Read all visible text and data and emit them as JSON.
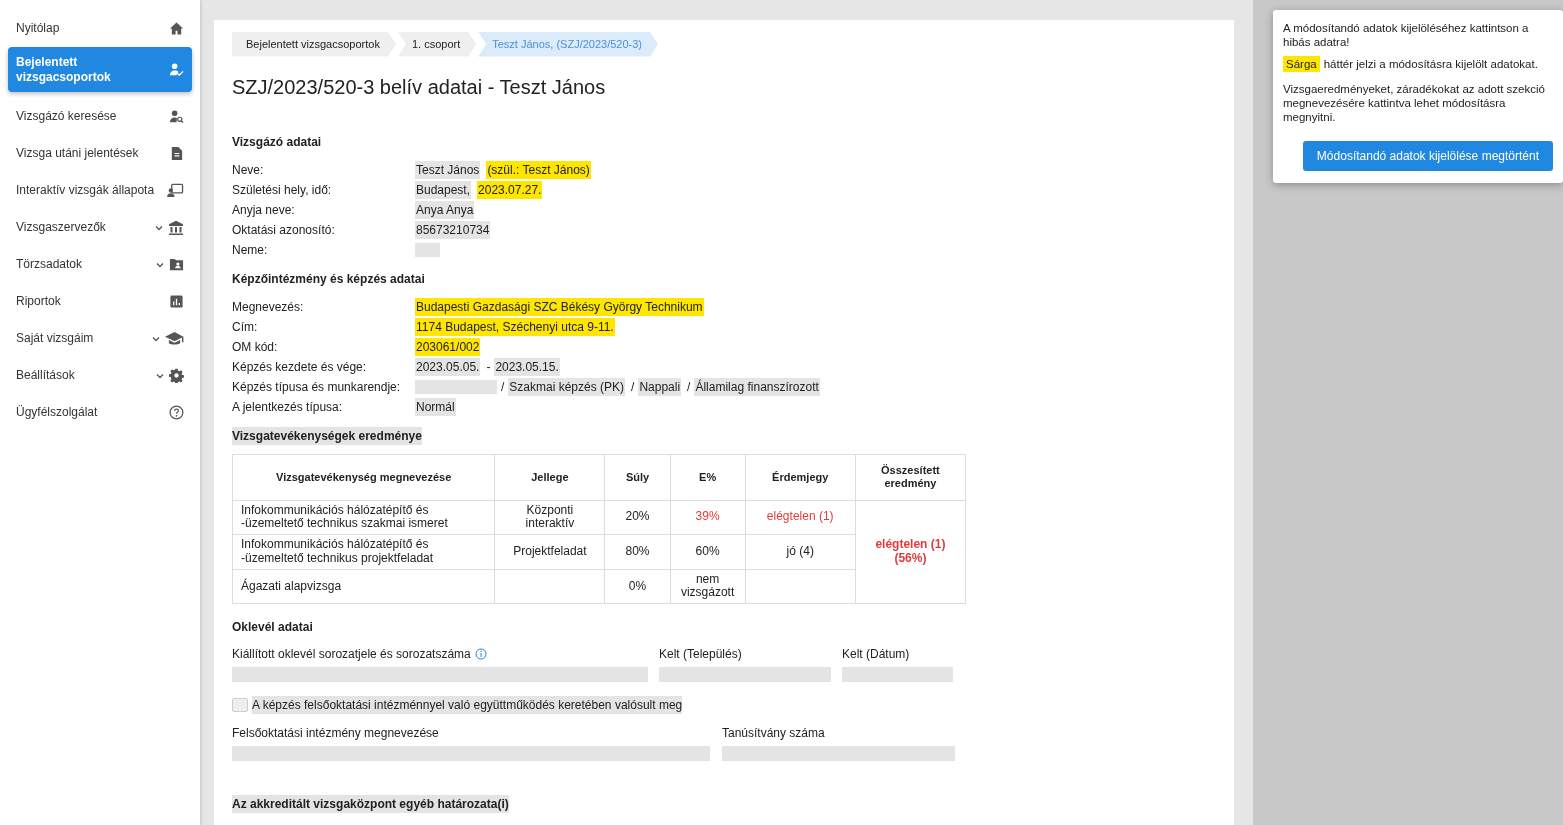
{
  "sidebar": {
    "items": [
      {
        "label": "Nyitólap",
        "selected": false,
        "expandable": false
      },
      {
        "label": "Bejelentett vizsgacsoportok",
        "selected": true,
        "expandable": false
      },
      {
        "label": "Vizsgázó keresése",
        "selected": false,
        "expandable": false
      },
      {
        "label": "Vizsga utáni jelentések",
        "selected": false,
        "expandable": false
      },
      {
        "label": "Interaktív vizsgák állapota",
        "selected": false,
        "expandable": false
      },
      {
        "label": "Vizsgaszervezők",
        "selected": false,
        "expandable": true
      },
      {
        "label": "Törzsadatok",
        "selected": false,
        "expandable": true
      },
      {
        "label": "Riportok",
        "selected": false,
        "expandable": false
      },
      {
        "label": "Saját vizsgáim",
        "selected": false,
        "expandable": true
      },
      {
        "label": "Beállítások",
        "selected": false,
        "expandable": true
      },
      {
        "label": "Ügyfélszolgálat",
        "selected": false,
        "expandable": false
      }
    ]
  },
  "breadcrumb": [
    {
      "label": "Bejelentett vizsgacsoportok",
      "selected": false
    },
    {
      "label": "1. csoport",
      "selected": false
    },
    {
      "label": "Teszt János, (SZJ/2023/520-3)",
      "selected": true
    }
  ],
  "title": "SZJ/2023/520-3 belív adatai - Teszt János",
  "sections": [
    {
      "heading": "Vizsgázó adatai",
      "editable": false,
      "fields": [
        {
          "label": "Neve:",
          "parts": [
            {
              "kind": "value",
              "text": "Teszt János",
              "marked": false
            },
            {
              "kind": "value",
              "text": "(szül.: Teszt János)",
              "marked": true
            }
          ]
        },
        {
          "label": "Születési hely, idő:",
          "parts": [
            {
              "kind": "value",
              "text": "Budapest,",
              "marked": false
            },
            {
              "kind": "value",
              "text": "2023.07.27.",
              "marked": true
            }
          ]
        },
        {
          "label": "Anyja neve:",
          "parts": [
            {
              "kind": "value",
              "text": "Anya Anya",
              "marked": false
            }
          ]
        },
        {
          "label": "Oktatási azonosító:",
          "parts": [
            {
              "kind": "value",
              "text": "85673210734",
              "marked": false
            }
          ]
        },
        {
          "label": "Neme:",
          "parts": [
            {
              "kind": "blank",
              "marked": false
            }
          ]
        }
      ]
    },
    {
      "heading": "Képzőintézmény és képzés adatai",
      "editable": false,
      "fields": [
        {
          "label": "Megnevezés:",
          "parts": [
            {
              "kind": "value",
              "text": "Budapesti Gazdasági SZC Békésy György Technikum",
              "marked": true
            }
          ]
        },
        {
          "label": "Cím:",
          "parts": [
            {
              "kind": "value",
              "text": "1174 Budapest, Széchenyi utca 9-11.",
              "marked": true
            }
          ]
        },
        {
          "label": "OM kód:",
          "parts": [
            {
              "kind": "value",
              "text": "203061/002",
              "marked": true
            }
          ]
        },
        {
          "label": "Képzés kezdete és vége:",
          "parts": [
            {
              "kind": "value",
              "text": "2023.05.05.",
              "marked": false
            },
            {
              "kind": "separator",
              "text": "-"
            },
            {
              "kind": "value",
              "text": "2023.05.15.",
              "marked": false
            }
          ]
        },
        {
          "label": "Képzés típusa és munkarendje:",
          "parts": [
            {
              "kind": "blank",
              "marked": false
            },
            {
              "kind": "separator",
              "text": "/"
            },
            {
              "kind": "value",
              "text": "Szakmai képzés (PK)",
              "marked": false
            },
            {
              "kind": "separator",
              "text": "/"
            },
            {
              "kind": "value",
              "text": "Nappali",
              "marked": false
            },
            {
              "kind": "separator",
              "text": "/"
            },
            {
              "kind": "value",
              "text": "Államilag finanszírozott",
              "marked": false
            }
          ]
        },
        {
          "label": "A jelentkezés típusa:",
          "parts": [
            {
              "kind": "value",
              "text": "Normál",
              "marked": false
            }
          ]
        }
      ]
    }
  ],
  "results": {
    "heading": "Vizsgatevékenységek eredménye",
    "editable": true,
    "columns": [
      "Vizsgatevékenység megnevezése",
      "Jellege",
      "Súly",
      "E%",
      "Érdemjegy",
      "Összesített eredmény"
    ],
    "rows": [
      {
        "name": "Infokommunikációs hálózatépítő és -üzemeltető technikus szakmai ismeret",
        "type": "Központi interaktív",
        "weight": "20%",
        "percent": "39%",
        "grade": "elégtelen (1)",
        "failed": true
      },
      {
        "name": "Infokommunikációs hálózatépítő és -üzemeltető technikus projektfeladat",
        "type": "Projektfeladat",
        "weight": "80%",
        "percent": "60%",
        "grade": "jó (4)",
        "failed": false
      },
      {
        "name": "Ágazati alapvizsga",
        "weight": "0%",
        "percent": "nem vizsgázott",
        "failed": false
      }
    ],
    "summary": {
      "grade": "elégtelen (1)",
      "percent": "(56%)",
      "failed": true
    }
  },
  "diploma": {
    "heading": "Oklevél adatai",
    "fields": [
      {
        "label": "Kiállított oklevél sorozatjele és sorozatszáma",
        "info": true
      },
      {
        "label": "Kelt (Település)",
        "info": false
      },
      {
        "label": "Kelt (Dátum)",
        "info": false
      }
    ],
    "checkbox": {
      "label": "A képzés felsőoktatási intézménnyel való együttműködés keretében valósult meg",
      "checked": false
    },
    "fields2": [
      {
        "label": "Felsőoktatási intézmény megnevezése",
        "info": false
      },
      {
        "label": "Tanúsítvány száma",
        "info": false
      }
    ]
  },
  "other": {
    "heading": "Az akkreditált vizsgaközpont egyéb határozata(i)",
    "editable": true
  },
  "help_panel": {
    "line1": "A módosítandó adatok kijelöléséhez kattintson a hibás adatra!",
    "highlight_word": "Sárga",
    "line2": "háttér jelzi a módosításra kijelölt adatokat.",
    "line3": "Vizsgaeredményeket, záradékokat az adott szekció megnevezésére kattintva lehet módosításra megnyitni.",
    "button": "Módosítandó adatok kijelölése megtörtént"
  }
}
